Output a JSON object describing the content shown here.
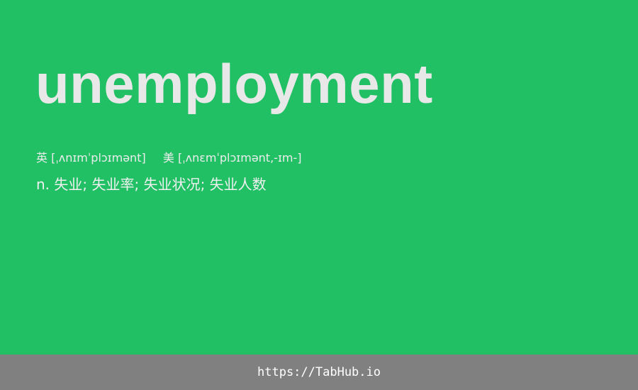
{
  "word": "unemployment",
  "pronunciation": {
    "uk_label": "英",
    "uk_ipa": "[ˌʌnɪmˈplɔɪmənt]",
    "us_label": "美",
    "us_ipa": "[ˌʌnɛmˈplɔɪmənt,-ɪm-]"
  },
  "definition": "n. 失业; 失业率; 失业状况; 失业人数",
  "footer": {
    "link_text": "https://TabHub.io"
  },
  "colors": {
    "background": "#22c065",
    "footer_background": "#808080",
    "word_text": "#e8e8e8"
  }
}
